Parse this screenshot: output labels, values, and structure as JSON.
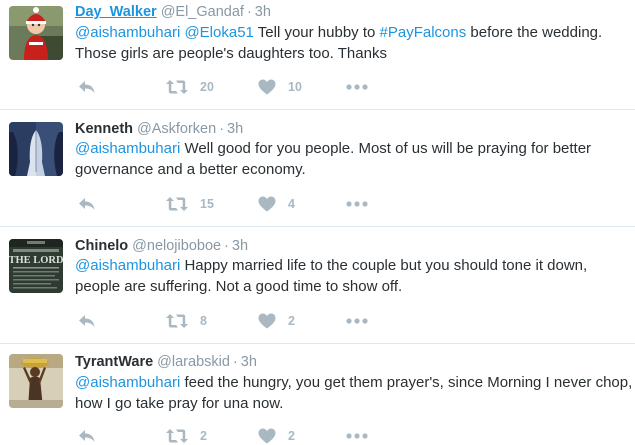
{
  "tweets": [
    {
      "name": "Day_Walker",
      "handle": "@El_Gandaf",
      "sep": "·",
      "time": "3h",
      "parts": [
        {
          "text": "@aishambuhari",
          "link": true
        },
        {
          "text": " ",
          "link": false
        },
        {
          "text": "@Eloka51",
          "link": true
        },
        {
          "text": " Tell your hubby  to ",
          "link": false
        },
        {
          "text": "#PayFalcons",
          "link": true
        },
        {
          "text": " before the wedding. Those girls are people's daughters too. Thanks",
          "link": false
        }
      ],
      "retweets": "20",
      "likes": "10"
    },
    {
      "name": "Kenneth",
      "handle": "@Askforken",
      "sep": "·",
      "time": "3h",
      "parts": [
        {
          "text": "@aishambuhari",
          "link": true
        },
        {
          "text": " Well good for you people. Most of us will be praying for better governance and a better economy.",
          "link": false
        }
      ],
      "retweets": "15",
      "likes": "4"
    },
    {
      "name": "Chinelo",
      "handle": "@nelojiboboe",
      "sep": "·",
      "time": "3h",
      "parts": [
        {
          "text": "@aishambuhari",
          "link": true
        },
        {
          "text": "  Happy married life to the couple but you should tone it down, people are suffering. Not a good time to show off.",
          "link": false
        }
      ],
      "retweets": "8",
      "likes": "2"
    },
    {
      "name": "TyrantWare",
      "handle": "@larabskid",
      "sep": "·",
      "time": "3h",
      "parts": [
        {
          "text": "@aishambuhari",
          "link": true
        },
        {
          "text": " feed the hungry, you get them prayer's, since Morning I never chop, how I go take pray for una now.",
          "link": false
        }
      ],
      "retweets": "2",
      "likes": "2"
    }
  ],
  "avatar_lettering": {
    "chinelo": "THE LORD"
  },
  "colors": {
    "link": "#1b95e0",
    "meta": "#8899a6",
    "action": "#aab8c2",
    "divider": "#e1e8ed",
    "text": "#292f33"
  },
  "icons": {
    "reply": "reply-arrow-icon",
    "retweet": "retweet-icon",
    "like": "heart-icon",
    "more": "more-dots-icon"
  }
}
